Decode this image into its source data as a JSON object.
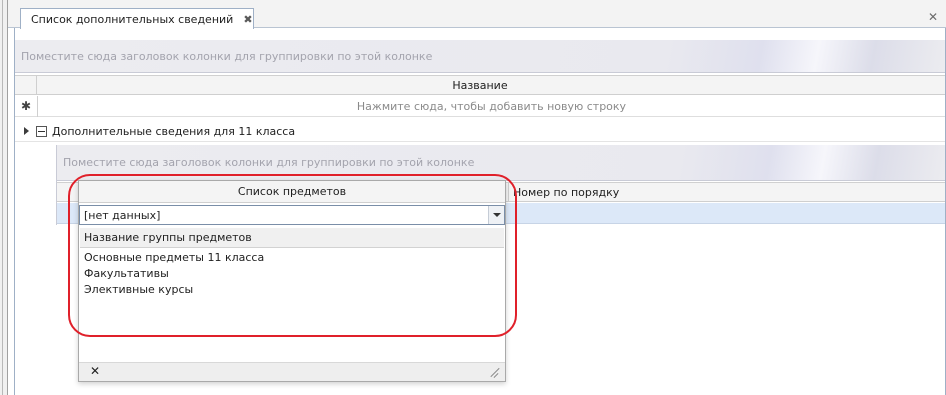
{
  "tab": {
    "title": "Список дополнительных сведений",
    "close_glyph": "✖"
  },
  "panel": {
    "close_glyph": "✕"
  },
  "outer_grid": {
    "group_panel_text": "Поместите сюда заголовок колонки для группировки по этой колонке",
    "column_header": "Название",
    "new_row_indicator": "✱",
    "new_row_text": "Нажмите сюда, чтобы добавить новую строку",
    "master_row_label": "Дополнительные сведения для 11 класса"
  },
  "detail_grid": {
    "group_panel_text": "Поместите сюда заголовок колонки для группировки по этой колонке",
    "columns": [
      "Список предметов",
      "Номер по порядку"
    ]
  },
  "dropdown": {
    "edit_value": "[нет данных]",
    "list_header": "Название группы предметов",
    "items": [
      "Основные предметы 11 класса",
      "Факультативы",
      "Элективные курсы"
    ],
    "close_glyph": "✕"
  },
  "colors": {
    "highlight": "#e0202a",
    "selected_row": "#dce8f8",
    "tab_border": "#9fb0c6"
  }
}
